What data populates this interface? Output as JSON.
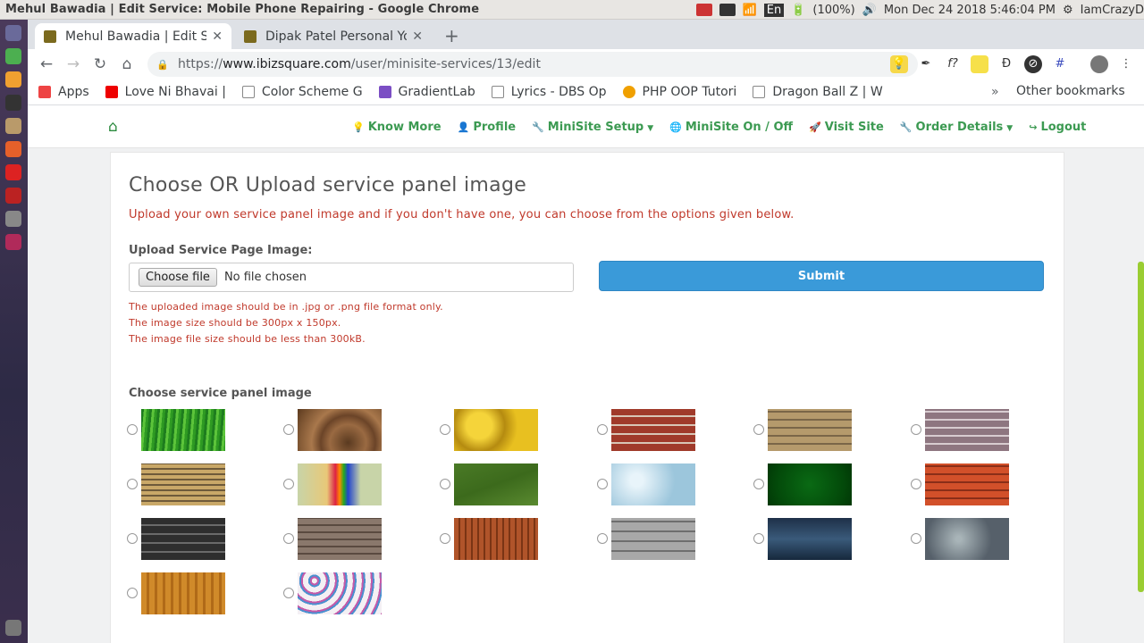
{
  "os": {
    "window_title": "Mehul Bawadia | Edit Service: Mobile Phone Repairing - Google Chrome",
    "battery": "(100%)",
    "datetime": "Mon Dec 24 2018  5:46:04 PM",
    "user": "IamCrazyD",
    "lang": "En"
  },
  "browser": {
    "tabs": [
      {
        "label": "Mehul Bawadia | Edit Serv"
      },
      {
        "label": "Dipak Patel Personal Yoga"
      }
    ],
    "url_scheme": "https://",
    "url_host": "www.ibizsquare.com",
    "url_path": "/user/minisite-services/13/edit",
    "bookmarks": [
      {
        "label": "Apps",
        "color": "#e44"
      },
      {
        "label": "Love Ni Bhavai |",
        "color": "#e00"
      },
      {
        "label": "Color Scheme G",
        "color": "#888"
      },
      {
        "label": "GradientLab",
        "color": "#7b4ec4"
      },
      {
        "label": "Lyrics - DBS Op",
        "color": "#888"
      },
      {
        "label": "PHP OOP Tutori",
        "color": "#f0a000"
      },
      {
        "label": "Dragon Ball Z | W",
        "color": "#888"
      }
    ],
    "other_bookmarks": "Other bookmarks"
  },
  "nav": {
    "links": [
      {
        "label": "Know More",
        "icon": "lightbulb-icon",
        "glyph": "💡",
        "caret": false
      },
      {
        "label": "Profile",
        "icon": "user-icon",
        "glyph": "👤",
        "caret": false
      },
      {
        "label": "MiniSite Setup",
        "icon": "wrench-icon",
        "glyph": "🔧",
        "caret": true
      },
      {
        "label": "MiniSite On / Off",
        "icon": "globe-icon",
        "glyph": "🌐",
        "caret": false
      },
      {
        "label": "Visit Site",
        "icon": "rocket-icon",
        "glyph": "🚀",
        "caret": false
      },
      {
        "label": "Order Details",
        "icon": "wrench-icon",
        "glyph": "🔧",
        "caret": true
      },
      {
        "label": "Logout",
        "icon": "logout-icon",
        "glyph": "↪",
        "caret": false
      }
    ]
  },
  "panel": {
    "heading": "Choose OR Upload service panel image",
    "subheading": "Upload your own service panel image and if you don't have one, you can choose from the options given below.",
    "upload_label": "Upload Service Page Image:",
    "choose_file": "Choose file",
    "no_file": "No file chosen",
    "submit": "Submit",
    "rules": [
      "The uploaded image should be in .jpg or .png file format only.",
      "The image size should be 300px x 150px.",
      "The image file size should be less than 300kB."
    ],
    "choose_label": "Choose service panel image",
    "images": [
      {
        "name": "grass",
        "bg": "repeating-linear-gradient(95deg,#1e7d1e 0 3px,#5cc43a 3px 6px,#2e9a22 6px 9px)"
      },
      {
        "name": "wood-rings",
        "bg": "radial-gradient(circle at 60% 80%,#5a3a20,#9a6a42 30%,#6b4428 45%,#a9784c 60%,#5c3a1e)"
      },
      {
        "name": "yellow-fruit",
        "bg": "radial-gradient(circle at 30% 40%,#f5d43a 20%,#b58b10 40%,#e8c020 60%)"
      },
      {
        "name": "red-brick",
        "bg": "repeating-linear-gradient(0deg,#a03a2a 0 8px,#d8c6b6 8px 10px)"
      },
      {
        "name": "tan-brick",
        "bg": "repeating-linear-gradient(0deg,#b59a6c 0 7px,#7a6648 7px 9px)"
      },
      {
        "name": "gray-brick",
        "bg": "repeating-linear-gradient(0deg,#8e7680 0 7px,#d8ccd0 7px 9px)"
      },
      {
        "name": "coins",
        "bg": "repeating-linear-gradient(0deg,#c9a868 0 4px,#6e5a3a 4px 6px)"
      },
      {
        "name": "rainbow-mug",
        "bg": "linear-gradient(90deg,#c8d4a8,#e8c878 35%,#d24 45%,#f80 50%,#2a2 55%,#24c 60%,#c8d4a8 75%)"
      },
      {
        "name": "lawn",
        "bg": "linear-gradient(160deg,#4a7a26,#3c6a1c 50%,#5a8a30)"
      },
      {
        "name": "water-drops",
        "bg": "radial-gradient(circle at 30% 40%,#e8f4fa 10%,#9cc6dc 60%)"
      },
      {
        "name": "green-rays",
        "bg": "radial-gradient(circle,#0a6a14,#034a0a 70%,#023806)"
      },
      {
        "name": "roof-tiles",
        "bg": "repeating-linear-gradient(0deg,#d2502a 0 7px,#8a2e18 7px 9px)"
      },
      {
        "name": "dark-stone",
        "bg": "repeating-linear-gradient(0deg,#2e2e2e 0 8px,#6a6a6a 8px 10px)"
      },
      {
        "name": "stone-wall",
        "bg": "repeating-linear-gradient(0deg,#8a786c 0 6px,#5a4a40 6px 8px)"
      },
      {
        "name": "wood-planks",
        "bg": "repeating-linear-gradient(90deg,#b0542a 0 5px,#7a3414 5px 7px)"
      },
      {
        "name": "gray-block",
        "bg": "repeating-linear-gradient(0deg,#a8a8a8 0 9px,#6e6e6e 9px 11px)"
      },
      {
        "name": "sea-water",
        "bg": "linear-gradient(180deg,#1e3048,#3a5a7a 50%,#16283c)"
      },
      {
        "name": "dark-drops",
        "bg": "radial-gradient(circle at 40% 50%,#a8b4b8 5%,#56606a 60%)"
      },
      {
        "name": "light-wood",
        "bg": "repeating-linear-gradient(90deg,#d08a2a 0 6px,#b06a18 6px 9px)"
      },
      {
        "name": "butterflies",
        "bg": "repeating-radial-gradient(circle at 20% 20%,#f4f0f4 0 3px,#c45aa8 3px 5px,#4a90d0 5px 7px,#f4f0f4 7px 10px)"
      }
    ]
  }
}
